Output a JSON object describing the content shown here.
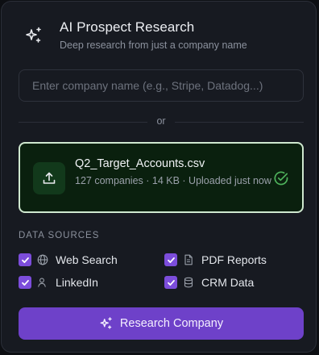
{
  "header": {
    "title": "AI Prospect Research",
    "subtitle": "Deep research from just a company name",
    "icon": "sparkles-icon"
  },
  "search": {
    "placeholder": "Enter company name (e.g., Stripe, Datadog...)",
    "value": ""
  },
  "divider": {
    "label": "or"
  },
  "upload": {
    "filename": "Q2_Target_Accounts.csv",
    "meta": "127 companies · 14 KB · Uploaded just now",
    "icon": "upload-icon",
    "status_icon": "check-circle-icon",
    "border_color": "#cfe8cf",
    "background": "#0a200e"
  },
  "data_sources": {
    "heading": "DATA SOURCES",
    "items": [
      {
        "label": "Web Search",
        "icon": "globe-icon",
        "checked": true
      },
      {
        "label": "PDF Reports",
        "icon": "document-icon",
        "checked": true
      },
      {
        "label": "LinkedIn",
        "icon": "user-icon",
        "checked": true
      },
      {
        "label": "CRM Data",
        "icon": "database-icon",
        "checked": true
      }
    ]
  },
  "action": {
    "label": "Research Company",
    "icon": "sparkles-icon",
    "color": "#6e41c9"
  },
  "colors": {
    "accent": "#7c4ddb",
    "success": "#4fb35c",
    "panel": "#171a21"
  }
}
